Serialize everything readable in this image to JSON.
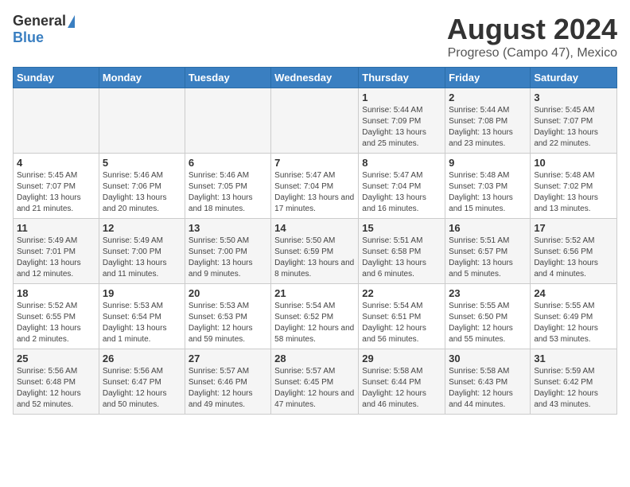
{
  "logo": {
    "line1": "General",
    "line2": "Blue"
  },
  "title": "August 2024",
  "subtitle": "Progreso (Campo 47), Mexico",
  "days_of_week": [
    "Sunday",
    "Monday",
    "Tuesday",
    "Wednesday",
    "Thursday",
    "Friday",
    "Saturday"
  ],
  "weeks": [
    [
      {
        "day": "",
        "sunrise": "",
        "sunset": "",
        "daylight": ""
      },
      {
        "day": "",
        "sunrise": "",
        "sunset": "",
        "daylight": ""
      },
      {
        "day": "",
        "sunrise": "",
        "sunset": "",
        "daylight": ""
      },
      {
        "day": "",
        "sunrise": "",
        "sunset": "",
        "daylight": ""
      },
      {
        "day": "1",
        "sunrise": "Sunrise: 5:44 AM",
        "sunset": "Sunset: 7:09 PM",
        "daylight": "Daylight: 13 hours and 25 minutes."
      },
      {
        "day": "2",
        "sunrise": "Sunrise: 5:44 AM",
        "sunset": "Sunset: 7:08 PM",
        "daylight": "Daylight: 13 hours and 23 minutes."
      },
      {
        "day": "3",
        "sunrise": "Sunrise: 5:45 AM",
        "sunset": "Sunset: 7:07 PM",
        "daylight": "Daylight: 13 hours and 22 minutes."
      }
    ],
    [
      {
        "day": "4",
        "sunrise": "Sunrise: 5:45 AM",
        "sunset": "Sunset: 7:07 PM",
        "daylight": "Daylight: 13 hours and 21 minutes."
      },
      {
        "day": "5",
        "sunrise": "Sunrise: 5:46 AM",
        "sunset": "Sunset: 7:06 PM",
        "daylight": "Daylight: 13 hours and 20 minutes."
      },
      {
        "day": "6",
        "sunrise": "Sunrise: 5:46 AM",
        "sunset": "Sunset: 7:05 PM",
        "daylight": "Daylight: 13 hours and 18 minutes."
      },
      {
        "day": "7",
        "sunrise": "Sunrise: 5:47 AM",
        "sunset": "Sunset: 7:04 PM",
        "daylight": "Daylight: 13 hours and 17 minutes."
      },
      {
        "day": "8",
        "sunrise": "Sunrise: 5:47 AM",
        "sunset": "Sunset: 7:04 PM",
        "daylight": "Daylight: 13 hours and 16 minutes."
      },
      {
        "day": "9",
        "sunrise": "Sunrise: 5:48 AM",
        "sunset": "Sunset: 7:03 PM",
        "daylight": "Daylight: 13 hours and 15 minutes."
      },
      {
        "day": "10",
        "sunrise": "Sunrise: 5:48 AM",
        "sunset": "Sunset: 7:02 PM",
        "daylight": "Daylight: 13 hours and 13 minutes."
      }
    ],
    [
      {
        "day": "11",
        "sunrise": "Sunrise: 5:49 AM",
        "sunset": "Sunset: 7:01 PM",
        "daylight": "Daylight: 13 hours and 12 minutes."
      },
      {
        "day": "12",
        "sunrise": "Sunrise: 5:49 AM",
        "sunset": "Sunset: 7:00 PM",
        "daylight": "Daylight: 13 hours and 11 minutes."
      },
      {
        "day": "13",
        "sunrise": "Sunrise: 5:50 AM",
        "sunset": "Sunset: 7:00 PM",
        "daylight": "Daylight: 13 hours and 9 minutes."
      },
      {
        "day": "14",
        "sunrise": "Sunrise: 5:50 AM",
        "sunset": "Sunset: 6:59 PM",
        "daylight": "Daylight: 13 hours and 8 minutes."
      },
      {
        "day": "15",
        "sunrise": "Sunrise: 5:51 AM",
        "sunset": "Sunset: 6:58 PM",
        "daylight": "Daylight: 13 hours and 6 minutes."
      },
      {
        "day": "16",
        "sunrise": "Sunrise: 5:51 AM",
        "sunset": "Sunset: 6:57 PM",
        "daylight": "Daylight: 13 hours and 5 minutes."
      },
      {
        "day": "17",
        "sunrise": "Sunrise: 5:52 AM",
        "sunset": "Sunset: 6:56 PM",
        "daylight": "Daylight: 13 hours and 4 minutes."
      }
    ],
    [
      {
        "day": "18",
        "sunrise": "Sunrise: 5:52 AM",
        "sunset": "Sunset: 6:55 PM",
        "daylight": "Daylight: 13 hours and 2 minutes."
      },
      {
        "day": "19",
        "sunrise": "Sunrise: 5:53 AM",
        "sunset": "Sunset: 6:54 PM",
        "daylight": "Daylight: 13 hours and 1 minute."
      },
      {
        "day": "20",
        "sunrise": "Sunrise: 5:53 AM",
        "sunset": "Sunset: 6:53 PM",
        "daylight": "Daylight: 12 hours and 59 minutes."
      },
      {
        "day": "21",
        "sunrise": "Sunrise: 5:54 AM",
        "sunset": "Sunset: 6:52 PM",
        "daylight": "Daylight: 12 hours and 58 minutes."
      },
      {
        "day": "22",
        "sunrise": "Sunrise: 5:54 AM",
        "sunset": "Sunset: 6:51 PM",
        "daylight": "Daylight: 12 hours and 56 minutes."
      },
      {
        "day": "23",
        "sunrise": "Sunrise: 5:55 AM",
        "sunset": "Sunset: 6:50 PM",
        "daylight": "Daylight: 12 hours and 55 minutes."
      },
      {
        "day": "24",
        "sunrise": "Sunrise: 5:55 AM",
        "sunset": "Sunset: 6:49 PM",
        "daylight": "Daylight: 12 hours and 53 minutes."
      }
    ],
    [
      {
        "day": "25",
        "sunrise": "Sunrise: 5:56 AM",
        "sunset": "Sunset: 6:48 PM",
        "daylight": "Daylight: 12 hours and 52 minutes."
      },
      {
        "day": "26",
        "sunrise": "Sunrise: 5:56 AM",
        "sunset": "Sunset: 6:47 PM",
        "daylight": "Daylight: 12 hours and 50 minutes."
      },
      {
        "day": "27",
        "sunrise": "Sunrise: 5:57 AM",
        "sunset": "Sunset: 6:46 PM",
        "daylight": "Daylight: 12 hours and 49 minutes."
      },
      {
        "day": "28",
        "sunrise": "Sunrise: 5:57 AM",
        "sunset": "Sunset: 6:45 PM",
        "daylight": "Daylight: 12 hours and 47 minutes."
      },
      {
        "day": "29",
        "sunrise": "Sunrise: 5:58 AM",
        "sunset": "Sunset: 6:44 PM",
        "daylight": "Daylight: 12 hours and 46 minutes."
      },
      {
        "day": "30",
        "sunrise": "Sunrise: 5:58 AM",
        "sunset": "Sunset: 6:43 PM",
        "daylight": "Daylight: 12 hours and 44 minutes."
      },
      {
        "day": "31",
        "sunrise": "Sunrise: 5:59 AM",
        "sunset": "Sunset: 6:42 PM",
        "daylight": "Daylight: 12 hours and 43 minutes."
      }
    ]
  ]
}
